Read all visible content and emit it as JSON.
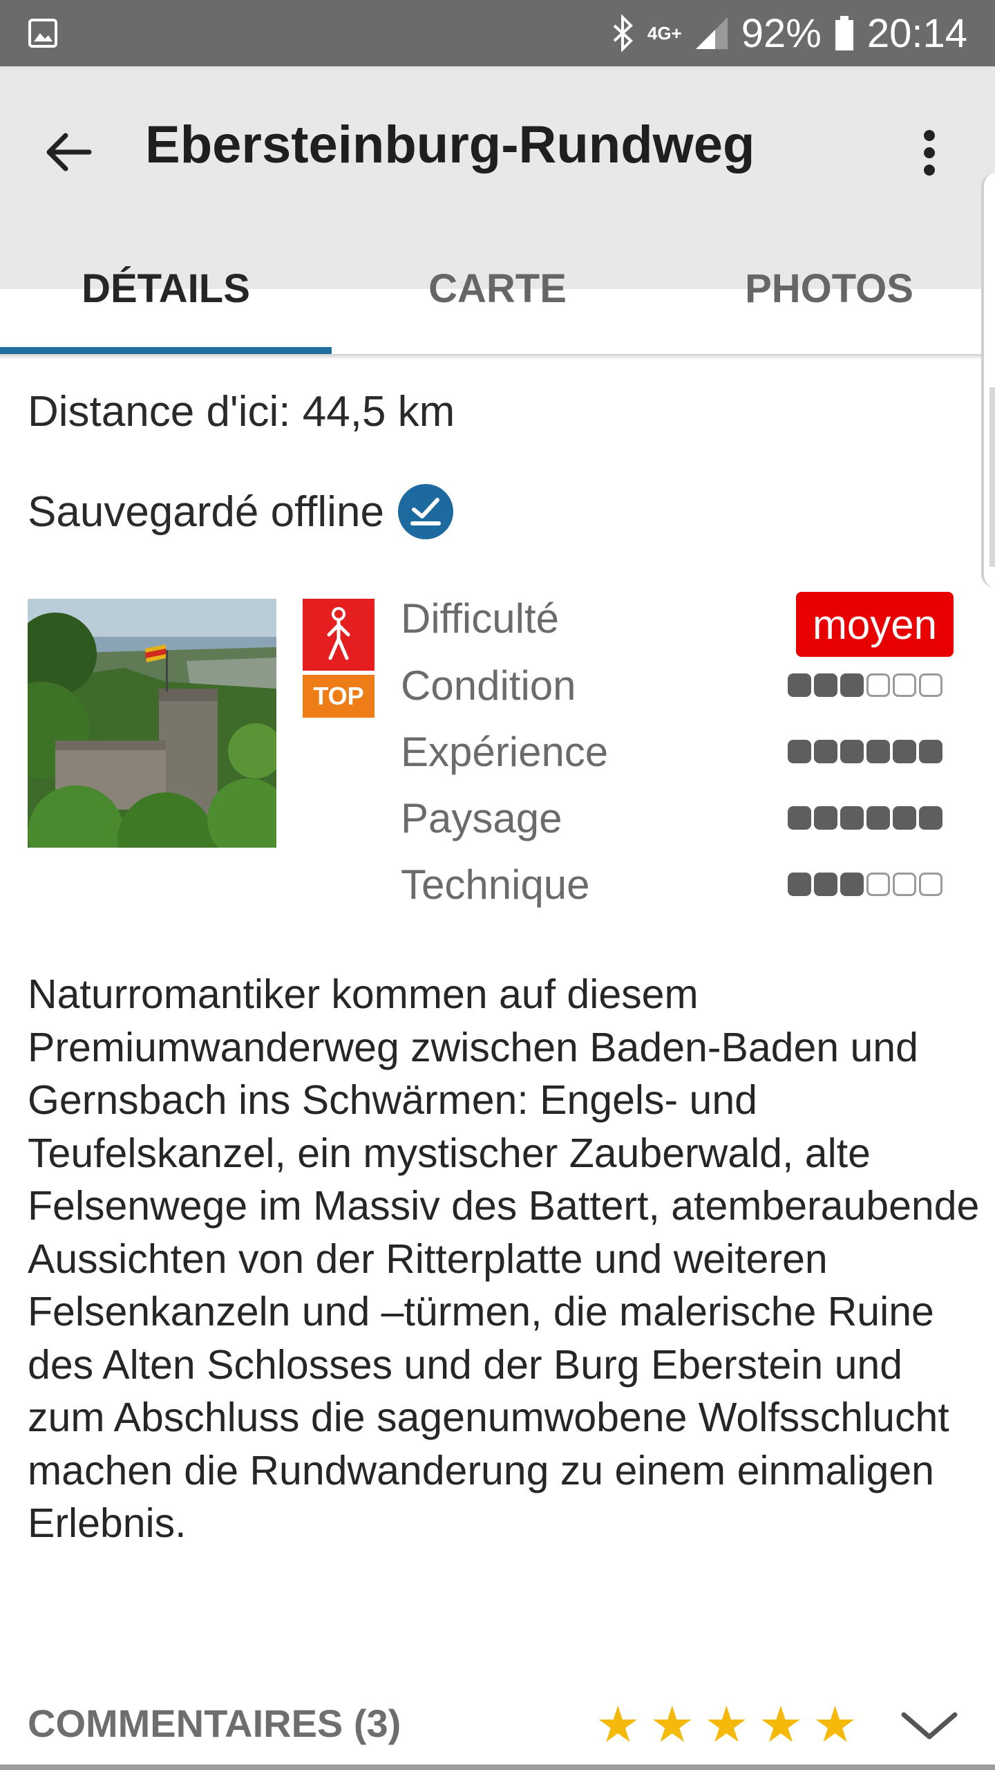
{
  "status_bar": {
    "network": "4G+",
    "battery": "92%",
    "time": "20:14"
  },
  "app_bar": {
    "title": "Ebersteinburg-Rundweg"
  },
  "tabs": [
    {
      "label": "DÉTAILS",
      "active": true
    },
    {
      "label": "CARTE",
      "active": false
    },
    {
      "label": "PHOTOS",
      "active": false
    }
  ],
  "details": {
    "distance": "Distance d'ici: 44,5 km",
    "offline": "Sauvegardé offline",
    "top_badge": "TOP",
    "ratings": [
      {
        "label": "Difficulté",
        "badge": "moyen"
      },
      {
        "label": "Condition",
        "filled": 3,
        "total": 6
      },
      {
        "label": "Expérience",
        "filled": 6,
        "total": 6
      },
      {
        "label": "Paysage",
        "filled": 6,
        "total": 6
      },
      {
        "label": "Technique",
        "filled": 3,
        "total": 6
      }
    ],
    "description": "Naturromantiker kommen auf diesem Premiumwanderweg zwischen Baden-Baden und Gernsbach ins Schwärmen: Engels- und Teufelskanzel, ein mystischer Zauberwald, alte Felsenwege im Massiv des Battert, atemberaubende Aussichten von der Ritterplatte und weiteren Felsenkanzeln und –türmen, die malerische Ruine des Alten Schlosses und der Burg Eberstein und zum Abschluss die sagenumwobene Wolfsschlucht machen die Rundwanderung zu einem einmaligen Erlebnis."
  },
  "comments": {
    "label": "COMMENTAIRES (3)",
    "rating": 5,
    "max_rating": 5
  },
  "colors": {
    "accent": "#1e6fa0",
    "difficulty": "#e80000",
    "top": "#ee7d18",
    "star": "#f5b90c"
  },
  "icons": [
    "gallery-icon",
    "bluetooth-icon",
    "signal-icon",
    "battery-icon",
    "back-arrow-icon",
    "more-vert-icon",
    "offline-check-icon",
    "hiker-icon",
    "star-icon",
    "chevron-down-icon"
  ]
}
